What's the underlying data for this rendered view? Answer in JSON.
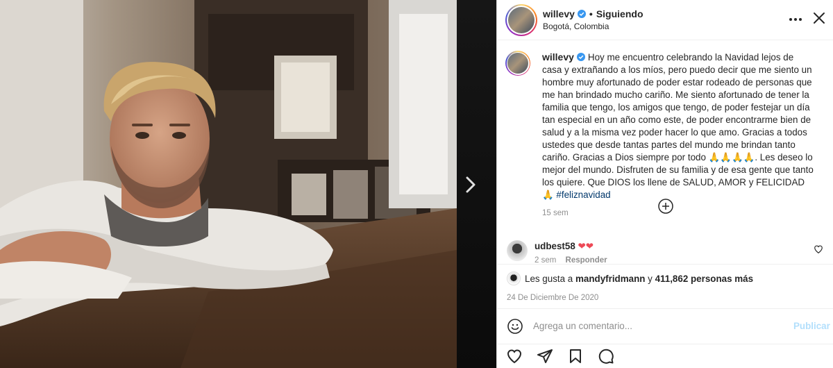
{
  "post": {
    "username": "willevy",
    "follow_state": "Siguiendo",
    "location": "Bogotá, Colombia",
    "caption": "Hoy me encuentro celebrando la Navidad lejos de casa y extrañando a los míos, pero puedo decir que me siento un hombre muy afortunado de poder estar rodeado de personas que me han brindado mucho cariño. Me siento afortunado de tener la familia que tengo, los amigos que tengo, de poder festejar un día tan especial en un año como este, de poder encontrarme bien de salud y a la misma vez poder hacer lo que amo. Gracias a todos ustedes que desde tantas partes del mundo me brindan tanto cariño. Gracias a Dios siempre por todo 🙏🙏🙏🙏. Les deseo lo mejor del mundo. Disfruten de su familia y de esa gente que tanto los quiere. Que DIOS los llene de SALUD, AMOR y FELICIDAD 🙏",
    "hashtag": "#feliznavidad",
    "caption_time": "15 sem"
  },
  "comment": {
    "username": "udbest58",
    "text": "❤❤",
    "time": "2 sem",
    "reply_label": "Responder"
  },
  "likes": {
    "prefix": "Les gusta a",
    "first_user": "mandyfridmann",
    "connector": "y",
    "others": "411,862 personas más"
  },
  "date": "24 De Diciembre De 2020",
  "comment_box": {
    "placeholder": "Agrega un comentario...",
    "publish_label": "Publicar"
  },
  "colors": {
    "verified": "#3897f0",
    "link": "#00376b",
    "publish_disabled": "#b2dffc",
    "heart": "#ed4956"
  },
  "icons": {
    "more": "more-horizontal-icon",
    "close": "close-icon",
    "next": "chevron-right-icon",
    "load_more": "plus-circle-icon",
    "like": "heart-icon",
    "comment": "comment-icon",
    "share": "send-icon",
    "save": "bookmark-icon",
    "emoji": "emoji-icon"
  }
}
